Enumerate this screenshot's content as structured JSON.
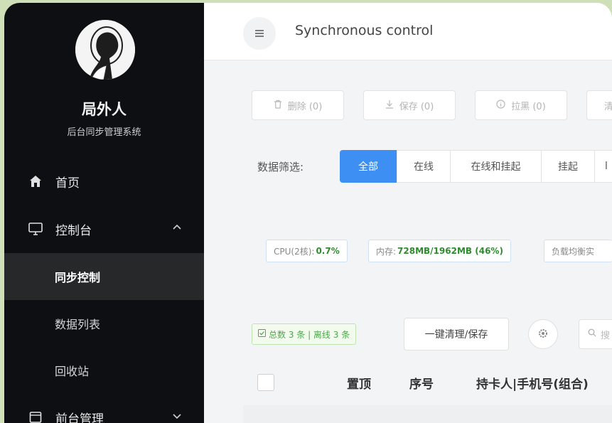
{
  "sidebar": {
    "brand_name": "局外人",
    "brand_subtitle": "后台同步管理系统",
    "items": [
      {
        "label": "首页",
        "icon": "home-icon"
      },
      {
        "label": "控制台",
        "icon": "monitor-icon",
        "expanded": true
      },
      {
        "label": "同步控制",
        "active": true
      },
      {
        "label": "数据列表"
      },
      {
        "label": "回收站"
      },
      {
        "label": "前台管理",
        "icon": "window-icon",
        "expanded": false
      }
    ]
  },
  "header": {
    "title": "Synchronous control",
    "menu_icon": "hamburger-icon"
  },
  "toolbar": {
    "delete_label": "删除 (0)",
    "save_label": "保存 (0)",
    "blacklist_label": "拉黑 (0)",
    "fourth_label_partial": "清"
  },
  "filter": {
    "label": "数据筛选:",
    "options": [
      "全部",
      "在线",
      "在线和挂起",
      "挂起",
      "l"
    ],
    "selected": "全部"
  },
  "stats": {
    "cpu_label": "CPU(2核):",
    "cpu_value": "0.7%",
    "mem_label": "内存:",
    "mem_value": "728MB/1962MB (46%)",
    "load_label": "负载均衡实"
  },
  "list_controls": {
    "total_text": "总数 3 条 | 离线 3 条",
    "clean_save_label": "一键清理/保存",
    "search_placeholder": "搜"
  },
  "table": {
    "columns": [
      "置顶",
      "序号",
      "持卡人|手机号(组合)"
    ]
  },
  "colors": {
    "sidebar_bg": "#0d0f12",
    "accent": "#3d8ff3",
    "success": "#2e8c2e"
  }
}
